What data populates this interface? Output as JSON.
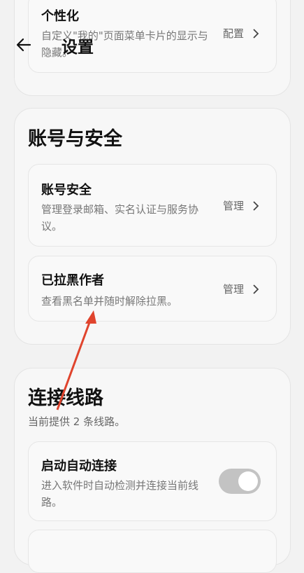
{
  "header": {
    "title": "设置"
  },
  "personalize": {
    "title": "个性化",
    "desc": "自定义\"我的\"页面菜单卡片的显示与隐藏。",
    "action": "配置"
  },
  "account": {
    "title": "账号与安全",
    "items": [
      {
        "title": "账号安全",
        "desc": "管理登录邮箱、实名认证与服务协议。",
        "action": "管理"
      },
      {
        "title": "已拉黑作者",
        "desc": "查看黑名单并随时解除拉黑。",
        "action": "管理"
      }
    ]
  },
  "connection": {
    "title": "连接线路",
    "subtitle": "当前提供 2 条线路。",
    "items": [
      {
        "title": "启动自动连接",
        "desc": "进入软件时自动检测并连接当前线路。",
        "toggle_on": true
      }
    ]
  },
  "colors": {
    "annotation_arrow": "#e0442d",
    "toggle_track": "#c3c3c3"
  },
  "icons": {
    "back": "back-arrow-icon",
    "chevron": "chevron-right-icon"
  }
}
